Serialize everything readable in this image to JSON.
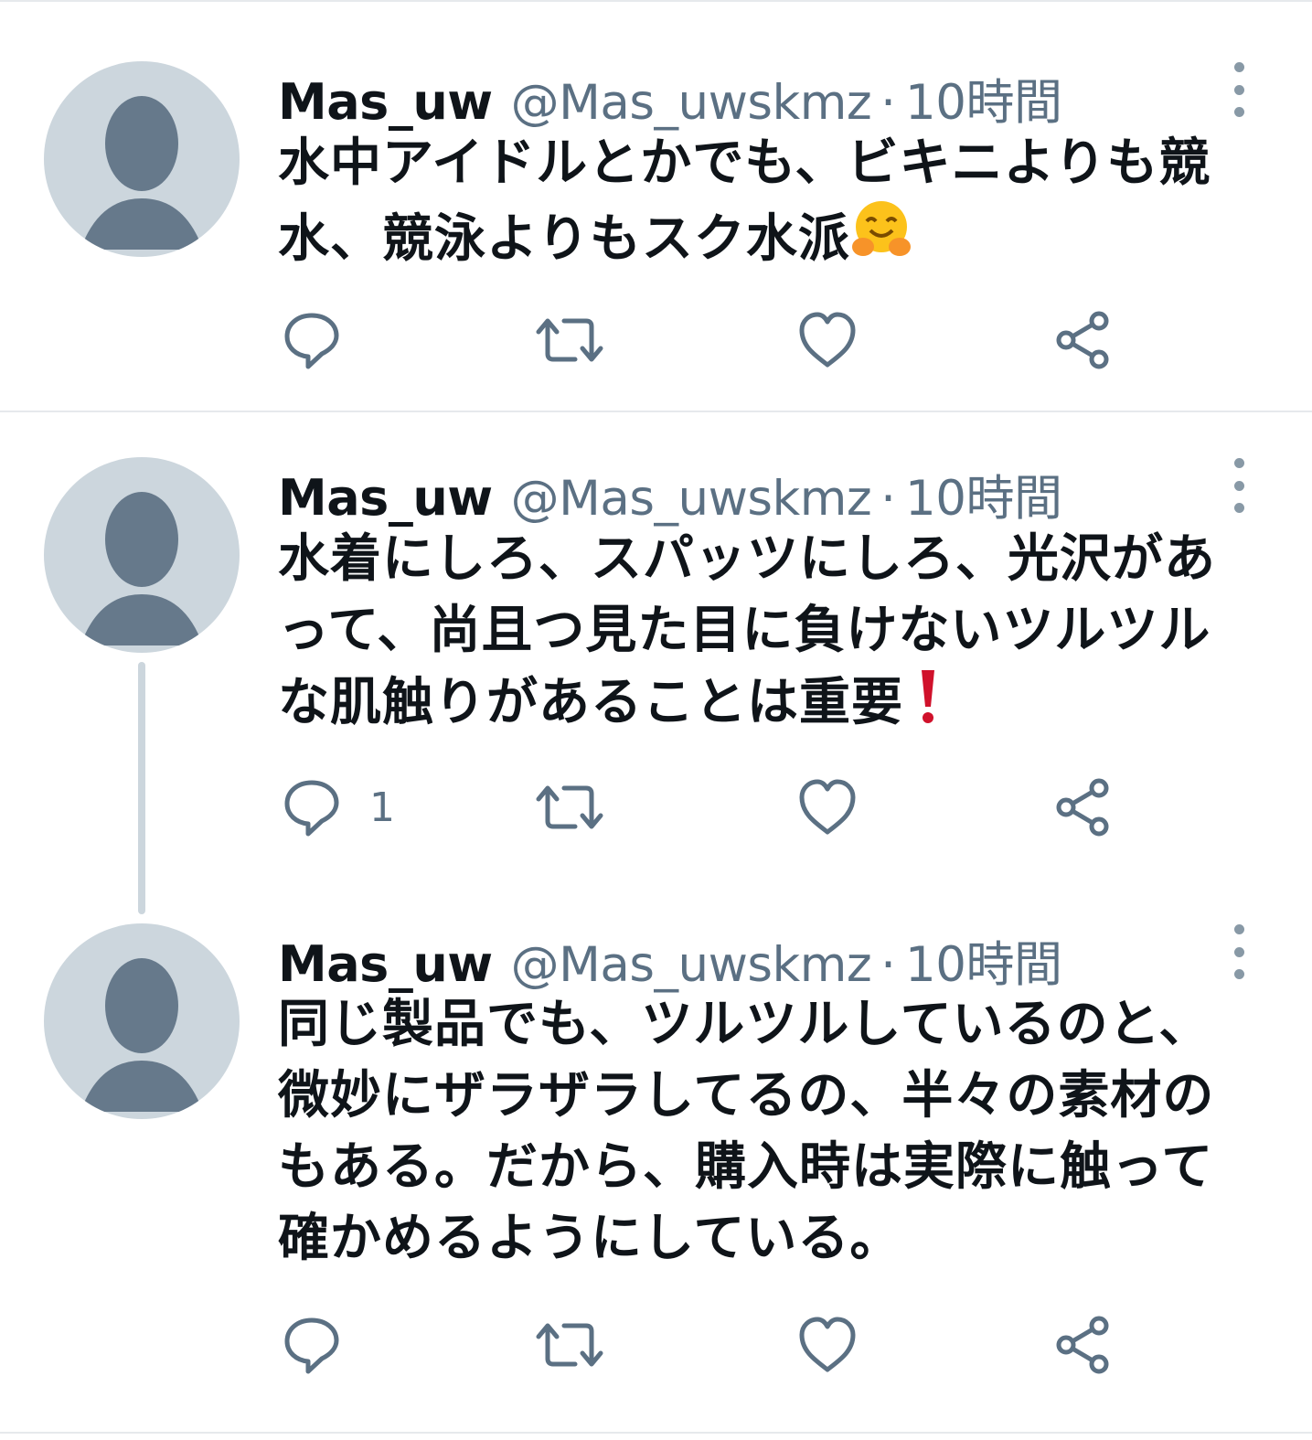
{
  "tweets": [
    {
      "name": "Mas_uw",
      "handle": "@Mas_uwskmz",
      "separator": "·",
      "time": "10時間",
      "text": "水中アイドルとかでも、ビキニよりも競\n水、競泳よりもスク水派",
      "emoji": "hugging-face-icon",
      "reply_count": "",
      "icons": [
        "reply-icon",
        "retweet-icon",
        "like-icon",
        "share-icon"
      ]
    },
    {
      "name": "Mas_uw",
      "handle": "@Mas_uwskmz",
      "separator": "·",
      "time": "10時間",
      "text": "水着にしろ、スパッツにしろ、光沢があ\nって、尚且つ見た目に負けないツルツル\nな肌触りがあることは重要",
      "emoji": "exclamation-icon",
      "reply_count": "1",
      "icons": [
        "reply-icon",
        "retweet-icon",
        "like-icon",
        "share-icon"
      ]
    },
    {
      "name": "Mas_uw",
      "handle": "@Mas_uwskmz",
      "separator": "·",
      "time": "10時間",
      "text": "同じ製品でも、ツルツルしているのと、\n微妙にザラザラしてるの、半々の素材の\nもある。だから、購入時は実際に触って\n確かめるようにしている。",
      "emoji": "",
      "reply_count": "",
      "icons": [
        "reply-icon",
        "retweet-icon",
        "like-icon",
        "share-icon"
      ]
    }
  ],
  "colors": {
    "text": "#0f1419",
    "secondary": "#5b7083",
    "avatar_bg": "#ccd6dd",
    "avatar_fg": "#66798b",
    "divider": "#e6e9ec"
  }
}
